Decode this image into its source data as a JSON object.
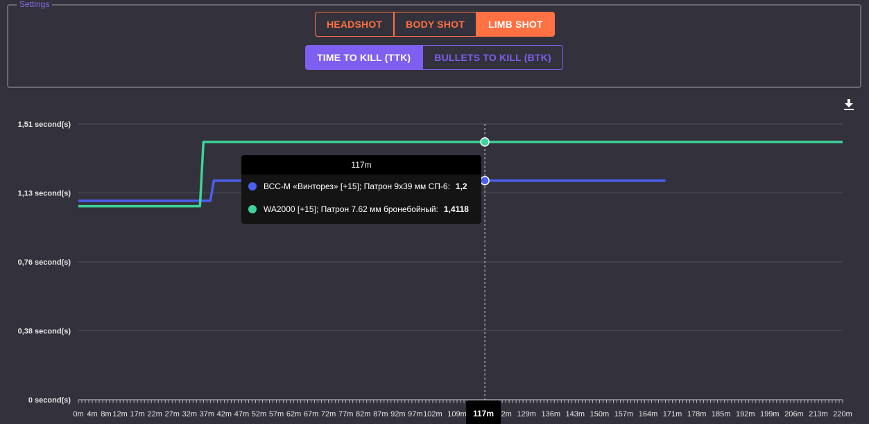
{
  "settings": {
    "legend": "Settings",
    "shot_buttons": [
      {
        "label": "HEADSHOT",
        "active": false
      },
      {
        "label": "BODY SHOT",
        "active": false
      },
      {
        "label": "LIMB SHOT",
        "active": true
      }
    ],
    "mode_buttons": [
      {
        "label": "TIME TO KILL (TTK)",
        "active": true
      },
      {
        "label": "BULLETS TO KILL (BTK)",
        "active": false
      }
    ]
  },
  "colors": {
    "background": "#33313b",
    "accent_orange": "#ff7043",
    "accent_purple": "#7e5ff0",
    "series_blue": "#4a5ff0",
    "series_green": "#3dd39a",
    "grid": "#55535c"
  },
  "toolbar": {
    "download_icon": "download-icon"
  },
  "tooltip": {
    "title": "117m",
    "rows": [
      {
        "label": "ВСС-М «Винторез» [+15]; Патрон 9х39 мм СП-6:",
        "value": "1,2",
        "color": "#4a5ff0"
      },
      {
        "label": "WA2000 [+15]; Патрон 7.62 мм бронебойный:",
        "value": "1,4118",
        "color": "#3dd39a"
      }
    ]
  },
  "crosshair": {
    "x_label": "117m",
    "x_value": 117
  },
  "chart_data": {
    "type": "line",
    "title": "",
    "xlabel": "",
    "ylabel": "",
    "xlim": [
      0,
      220
    ],
    "ylim": [
      0,
      1.51
    ],
    "y_ticks": [
      {
        "value": 0,
        "label": "0 second(s)"
      },
      {
        "value": 0.3775,
        "label": "0,38 second(s)"
      },
      {
        "value": 0.755,
        "label": "0,76 second(s)"
      },
      {
        "value": 1.1325,
        "label": "1,13 second(s)"
      },
      {
        "value": 1.51,
        "label": "1,51 second(s)"
      }
    ],
    "x_tick_labels": [
      {
        "value": 0,
        "label": "0m"
      },
      {
        "value": 4,
        "label": "4m"
      },
      {
        "value": 8,
        "label": "8m"
      },
      {
        "value": 12,
        "label": "12m"
      },
      {
        "value": 17,
        "label": "17m"
      },
      {
        "value": 22,
        "label": "22m"
      },
      {
        "value": 27,
        "label": "27m"
      },
      {
        "value": 32,
        "label": "32m"
      },
      {
        "value": 37,
        "label": "37m"
      },
      {
        "value": 42,
        "label": "42m"
      },
      {
        "value": 47,
        "label": "47m"
      },
      {
        "value": 52,
        "label": "52m"
      },
      {
        "value": 57,
        "label": "57m"
      },
      {
        "value": 62,
        "label": "62m"
      },
      {
        "value": 67,
        "label": "67m"
      },
      {
        "value": 72,
        "label": "72m"
      },
      {
        "value": 77,
        "label": "77m"
      },
      {
        "value": 82,
        "label": "82m"
      },
      {
        "value": 87,
        "label": "87m"
      },
      {
        "value": 92,
        "label": "92m"
      },
      {
        "value": 97,
        "label": "97m"
      },
      {
        "value": 102,
        "label": "102m"
      },
      {
        "value": 109,
        "label": "109m"
      },
      {
        "value": 122,
        "label": "122m"
      },
      {
        "value": 129,
        "label": "129m"
      },
      {
        "value": 136,
        "label": "136m"
      },
      {
        "value": 143,
        "label": "143m"
      },
      {
        "value": 150,
        "label": "150m"
      },
      {
        "value": 157,
        "label": "157m"
      },
      {
        "value": 164,
        "label": "164m"
      },
      {
        "value": 171,
        "label": "171m"
      },
      {
        "value": 178,
        "label": "178m"
      },
      {
        "value": 185,
        "label": "185m"
      },
      {
        "value": 192,
        "label": "192m"
      },
      {
        "value": 199,
        "label": "199m"
      },
      {
        "value": 206,
        "label": "206m"
      },
      {
        "value": 213,
        "label": "213m"
      },
      {
        "value": 220,
        "label": "220m"
      }
    ],
    "grid": true,
    "legend": "none",
    "series": [
      {
        "name": "ВСС-М «Винторез» [+15]; Патрон 9х39 мм СП-6",
        "color": "#4a5ff0",
        "points": [
          [
            0,
            1.09
          ],
          [
            38,
            1.09
          ],
          [
            39,
            1.2
          ],
          [
            169,
            1.2
          ]
        ]
      },
      {
        "name": "WA2000 [+15]; Патрон 7.62 мм бронебойный",
        "color": "#3dd39a",
        "points": [
          [
            0,
            1.06
          ],
          [
            35,
            1.06
          ],
          [
            36,
            1.4118
          ],
          [
            220,
            1.4118
          ]
        ]
      }
    ]
  }
}
